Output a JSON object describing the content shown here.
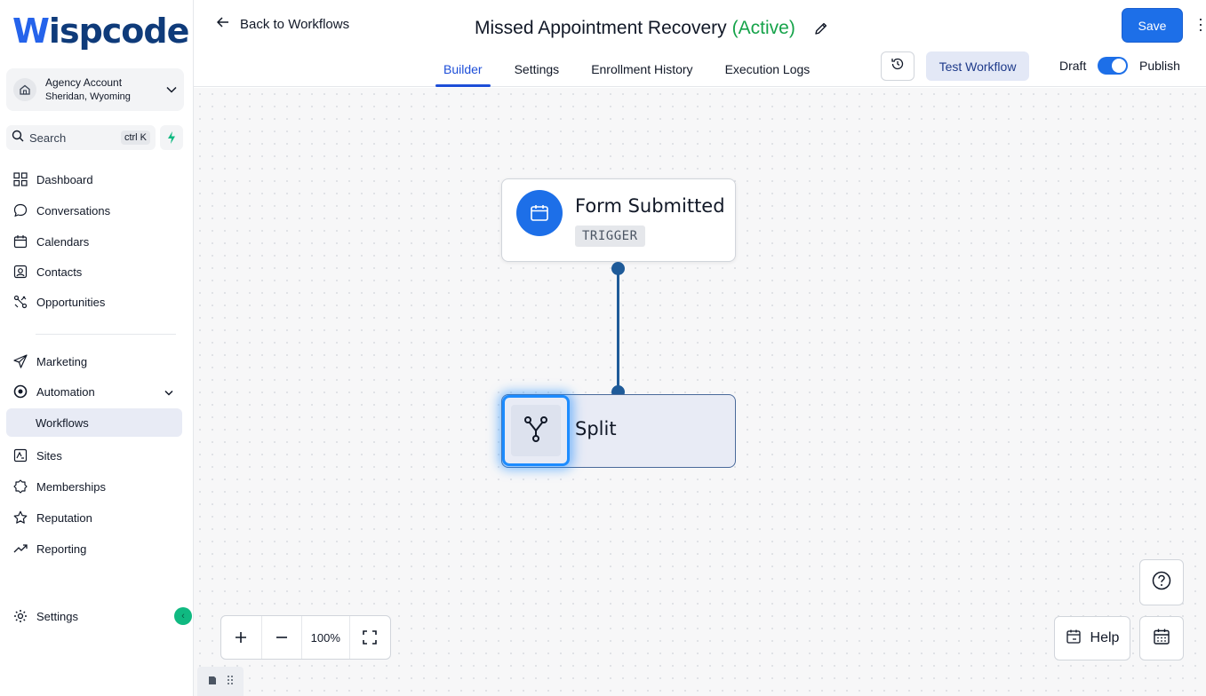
{
  "brand": {
    "logo_first": "W",
    "logo_rest": "ispcode"
  },
  "account": {
    "name": "Agency Account",
    "location": "Sheridan, Wyoming"
  },
  "search": {
    "label": "Search",
    "shortcut": "ctrl K"
  },
  "sidebar": {
    "items": [
      {
        "label": "Dashboard",
        "icon": "grid-icon"
      },
      {
        "label": "Conversations",
        "icon": "chat-bubble-icon"
      },
      {
        "label": "Calendars",
        "icon": "calendar-icon"
      },
      {
        "label": "Contacts",
        "icon": "contact-card-icon"
      },
      {
        "label": "Opportunities",
        "icon": "opportunities-icon"
      },
      {
        "label": "Marketing",
        "icon": "paper-plane-icon"
      },
      {
        "label": "Automation",
        "icon": "automation-icon"
      },
      {
        "label": "Workflows",
        "icon": "",
        "active": true
      },
      {
        "label": "Sites",
        "icon": "sites-icon"
      },
      {
        "label": "Memberships",
        "icon": "badge-icon"
      },
      {
        "label": "Reputation",
        "icon": "star-icon"
      },
      {
        "label": "Reporting",
        "icon": "trend-icon"
      }
    ],
    "settings_label": "Settings"
  },
  "header": {
    "back_label": "Back to Workflows",
    "workflow_title": "Missed Appointment Recovery",
    "workflow_status": "(Active)",
    "save_label": "Save",
    "tabs": [
      "Builder",
      "Settings",
      "Enrollment History",
      "Execution Logs"
    ],
    "active_tab": "Builder",
    "test_label": "Test Workflow",
    "draft_label": "Draft",
    "publish_label": "Publish",
    "publish_on": true
  },
  "canvas": {
    "trigger_node": {
      "title": "Form Submitted",
      "badge": "TRIGGER"
    },
    "action_node": {
      "title": "Split"
    },
    "zoom": "100%",
    "help_label": "Help"
  },
  "colors": {
    "accent": "#1d6fe8",
    "active_status": "#16a34a",
    "connector": "#1f5b99"
  }
}
